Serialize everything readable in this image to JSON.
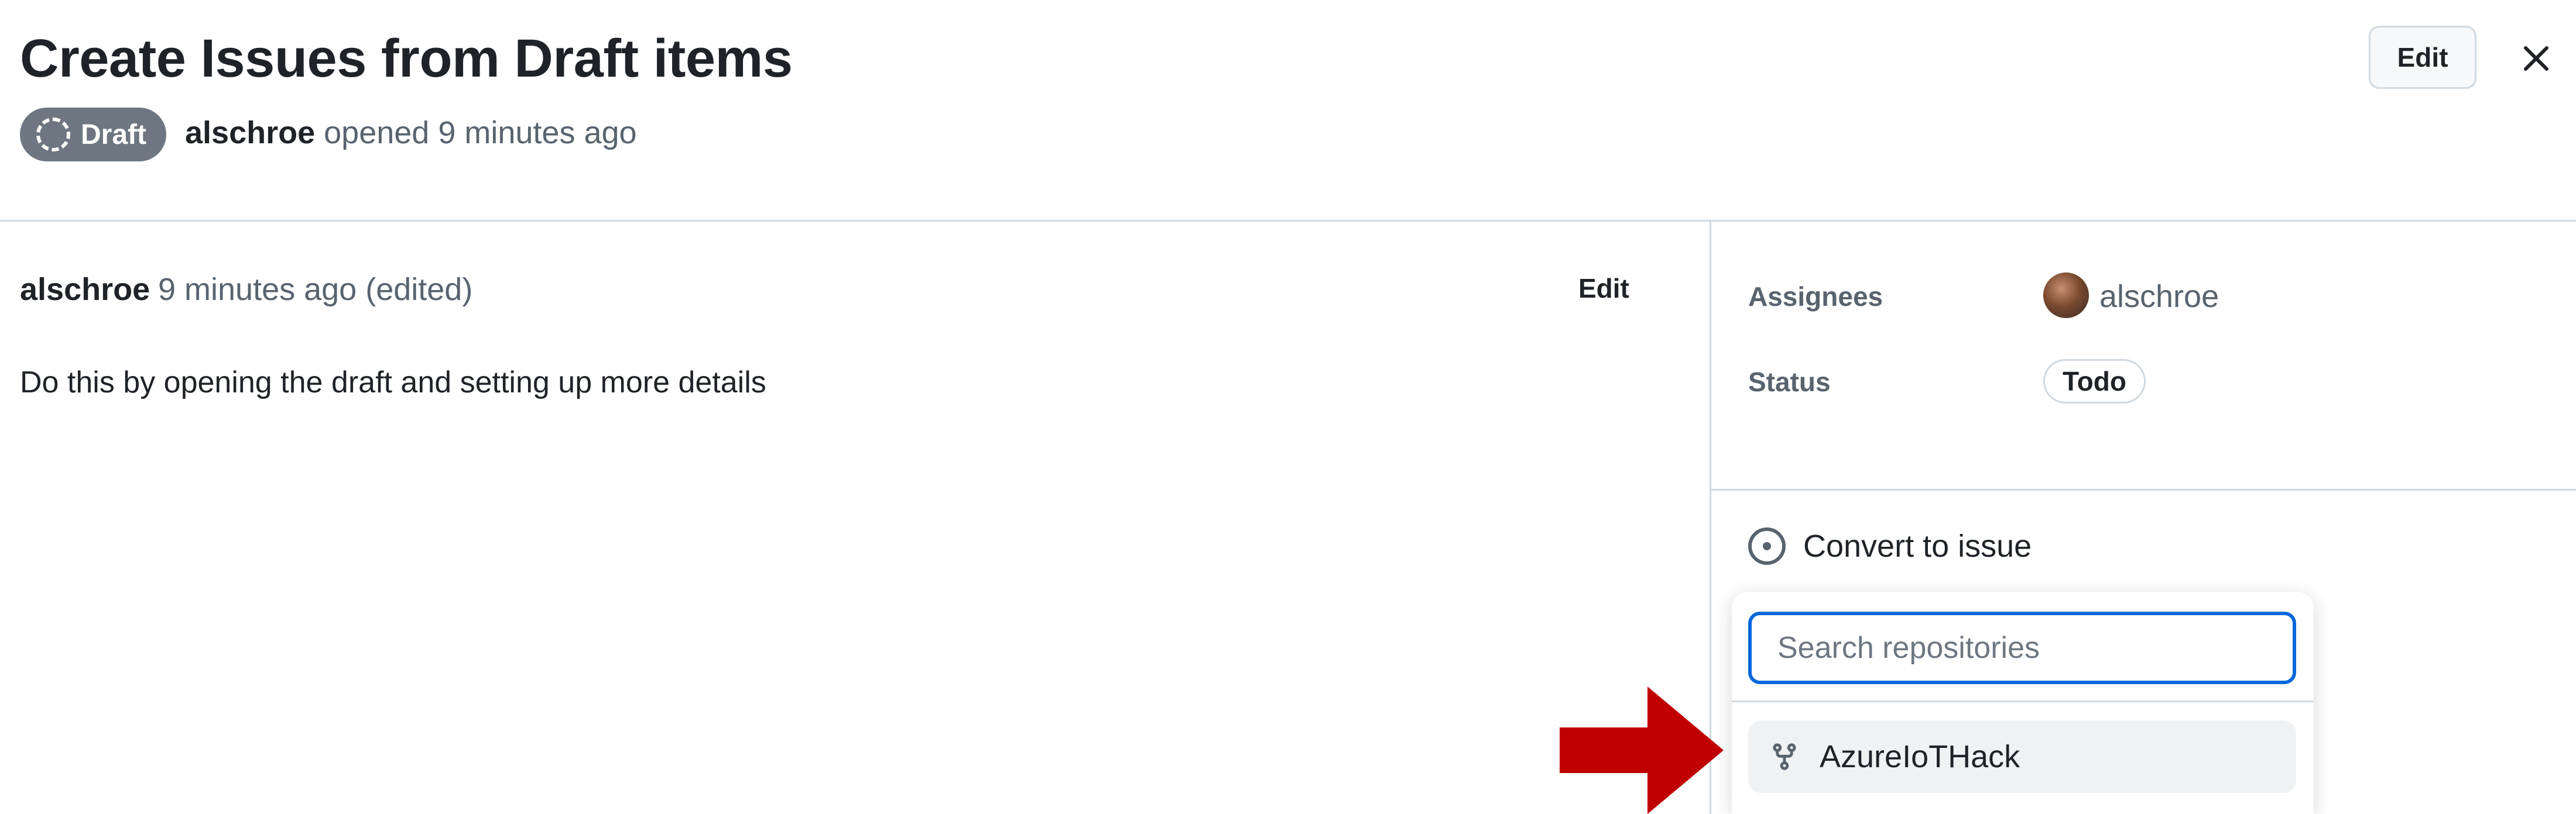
{
  "header": {
    "title": "Create Issues from Draft items",
    "badge_label": "Draft",
    "author": "alschroe",
    "opened_text": "opened 9 minutes ago",
    "edit_label": "Edit",
    "close_icon": "close-icon"
  },
  "comment": {
    "author": "alschroe",
    "time": "9 minutes ago (edited)",
    "edit_label": "Edit",
    "body": "Do this by opening the draft and setting up more details"
  },
  "sidebar": {
    "assignees_label": "Assignees",
    "assignee_name": "alschroe",
    "status_label": "Status",
    "status_value": "Todo",
    "convert_label": "Convert to issue"
  },
  "dropdown": {
    "search_placeholder": "Search repositories",
    "search_value": "",
    "items": [
      {
        "label": "AzureIoTHack",
        "icon": "repo-forked-icon"
      }
    ]
  },
  "annotation": {
    "arrow_color": "#c00000"
  },
  "colors": {
    "accent": "#0969da",
    "draft_badge": "#6e7781",
    "border": "#d1d9e0"
  }
}
